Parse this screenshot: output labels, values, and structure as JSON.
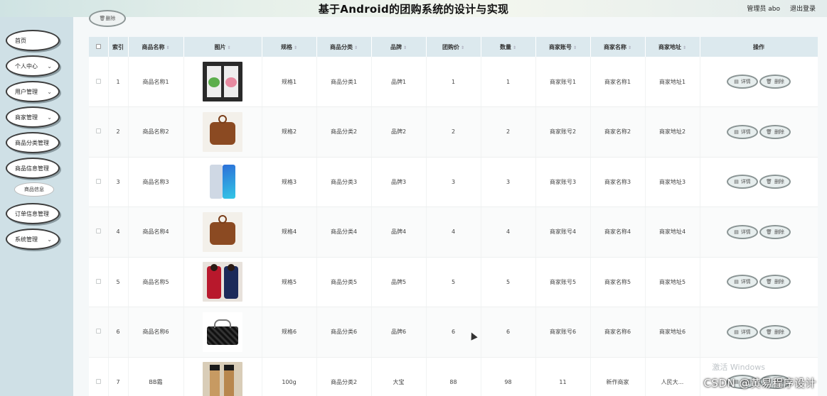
{
  "header": {
    "title": "基于Android的团购系统的设计与实现",
    "admin_label": "管理员 abo",
    "logout_label": "退出登录"
  },
  "sidebar": {
    "items": [
      {
        "label": "首页",
        "chev": ""
      },
      {
        "label": "个人中心",
        "chev": "⌄"
      },
      {
        "label": "用户管理",
        "chev": "⌄"
      },
      {
        "label": "商家管理",
        "chev": "⌄"
      },
      {
        "label": "商品分类管理",
        "chev": ""
      },
      {
        "label": "商品信息管理",
        "chev": ""
      },
      {
        "label": "订单信息管理",
        "chev": ""
      },
      {
        "label": "系统管理",
        "chev": "⌄"
      }
    ],
    "subitem": "商品信息"
  },
  "toolbar": {
    "delete_label": "删除"
  },
  "table": {
    "headers": [
      "索引",
      "商品名称",
      "图片",
      "规格",
      "商品分类",
      "品牌",
      "团购价",
      "数量",
      "商家账号",
      "商家名称",
      "商家地址",
      "操作"
    ],
    "rows": [
      {
        "idx": "1",
        "name": "商品名称1",
        "spec": "规格1",
        "cat": "商品分类1",
        "brand": "品牌1",
        "price": "1",
        "qty": "1",
        "acct": "商家账号1",
        "mname": "商家名称1",
        "addr": "商家地址1"
      },
      {
        "idx": "2",
        "name": "商品名称2",
        "spec": "规格2",
        "cat": "商品分类2",
        "brand": "品牌2",
        "price": "2",
        "qty": "2",
        "acct": "商家账号2",
        "mname": "商家名称2",
        "addr": "商家地址2"
      },
      {
        "idx": "3",
        "name": "商品名称3",
        "spec": "规格3",
        "cat": "商品分类3",
        "brand": "品牌3",
        "price": "3",
        "qty": "3",
        "acct": "商家账号3",
        "mname": "商家名称3",
        "addr": "商家地址3"
      },
      {
        "idx": "4",
        "name": "商品名称4",
        "spec": "规格4",
        "cat": "商品分类4",
        "brand": "品牌4",
        "price": "4",
        "qty": "4",
        "acct": "商家账号4",
        "mname": "商家名称4",
        "addr": "商家地址4"
      },
      {
        "idx": "5",
        "name": "商品名称5",
        "spec": "规格5",
        "cat": "商品分类5",
        "brand": "品牌5",
        "price": "5",
        "qty": "5",
        "acct": "商家账号5",
        "mname": "商家名称5",
        "addr": "商家地址5"
      },
      {
        "idx": "6",
        "name": "商品名称6",
        "spec": "规格6",
        "cat": "商品分类6",
        "brand": "品牌6",
        "price": "6",
        "qty": "6",
        "acct": "商家账号6",
        "mname": "商家名称6",
        "addr": "商家地址6"
      },
      {
        "idx": "7",
        "name": "BB霜",
        "spec": "100g",
        "cat": "商品分类2",
        "brand": "大宝",
        "price": "88",
        "qty": "98",
        "acct": "11",
        "mname": "新作商家",
        "addr": "人民大..."
      }
    ],
    "detail_label": "详情",
    "delete_label": "删除"
  },
  "overlay": {
    "windows_note": "激活 Windows",
    "watermark": "CSDN @黄易程序设计"
  }
}
